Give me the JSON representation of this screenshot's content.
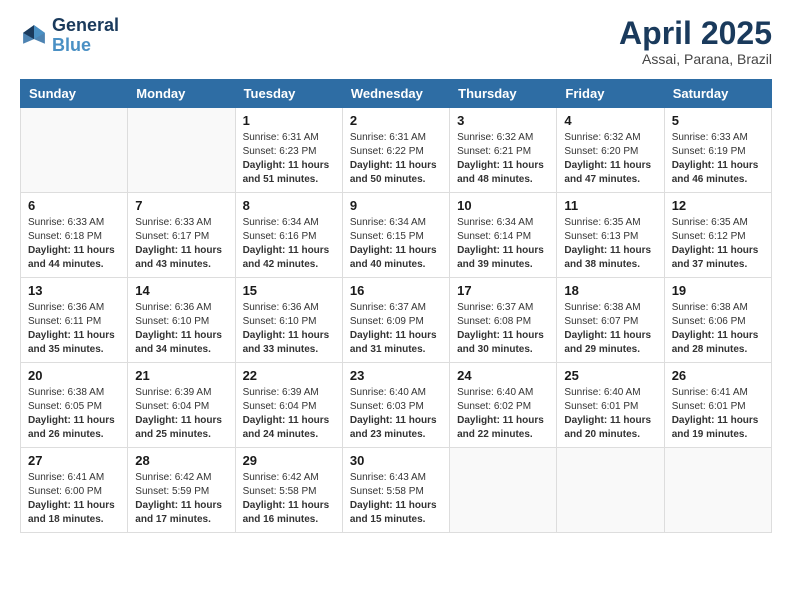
{
  "logo": {
    "line1": "General",
    "line2": "Blue"
  },
  "title": "April 2025",
  "subtitle": "Assai, Parana, Brazil",
  "days_of_week": [
    "Sunday",
    "Monday",
    "Tuesday",
    "Wednesday",
    "Thursday",
    "Friday",
    "Saturday"
  ],
  "weeks": [
    [
      {
        "day": "",
        "content": ""
      },
      {
        "day": "",
        "content": ""
      },
      {
        "day": "1",
        "content": "Sunrise: 6:31 AM\nSunset: 6:23 PM\nDaylight: 11 hours and 51 minutes."
      },
      {
        "day": "2",
        "content": "Sunrise: 6:31 AM\nSunset: 6:22 PM\nDaylight: 11 hours and 50 minutes."
      },
      {
        "day": "3",
        "content": "Sunrise: 6:32 AM\nSunset: 6:21 PM\nDaylight: 11 hours and 48 minutes."
      },
      {
        "day": "4",
        "content": "Sunrise: 6:32 AM\nSunset: 6:20 PM\nDaylight: 11 hours and 47 minutes."
      },
      {
        "day": "5",
        "content": "Sunrise: 6:33 AM\nSunset: 6:19 PM\nDaylight: 11 hours and 46 minutes."
      }
    ],
    [
      {
        "day": "6",
        "content": "Sunrise: 6:33 AM\nSunset: 6:18 PM\nDaylight: 11 hours and 44 minutes."
      },
      {
        "day": "7",
        "content": "Sunrise: 6:33 AM\nSunset: 6:17 PM\nDaylight: 11 hours and 43 minutes."
      },
      {
        "day": "8",
        "content": "Sunrise: 6:34 AM\nSunset: 6:16 PM\nDaylight: 11 hours and 42 minutes."
      },
      {
        "day": "9",
        "content": "Sunrise: 6:34 AM\nSunset: 6:15 PM\nDaylight: 11 hours and 40 minutes."
      },
      {
        "day": "10",
        "content": "Sunrise: 6:34 AM\nSunset: 6:14 PM\nDaylight: 11 hours and 39 minutes."
      },
      {
        "day": "11",
        "content": "Sunrise: 6:35 AM\nSunset: 6:13 PM\nDaylight: 11 hours and 38 minutes."
      },
      {
        "day": "12",
        "content": "Sunrise: 6:35 AM\nSunset: 6:12 PM\nDaylight: 11 hours and 37 minutes."
      }
    ],
    [
      {
        "day": "13",
        "content": "Sunrise: 6:36 AM\nSunset: 6:11 PM\nDaylight: 11 hours and 35 minutes."
      },
      {
        "day": "14",
        "content": "Sunrise: 6:36 AM\nSunset: 6:10 PM\nDaylight: 11 hours and 34 minutes."
      },
      {
        "day": "15",
        "content": "Sunrise: 6:36 AM\nSunset: 6:10 PM\nDaylight: 11 hours and 33 minutes."
      },
      {
        "day": "16",
        "content": "Sunrise: 6:37 AM\nSunset: 6:09 PM\nDaylight: 11 hours and 31 minutes."
      },
      {
        "day": "17",
        "content": "Sunrise: 6:37 AM\nSunset: 6:08 PM\nDaylight: 11 hours and 30 minutes."
      },
      {
        "day": "18",
        "content": "Sunrise: 6:38 AM\nSunset: 6:07 PM\nDaylight: 11 hours and 29 minutes."
      },
      {
        "day": "19",
        "content": "Sunrise: 6:38 AM\nSunset: 6:06 PM\nDaylight: 11 hours and 28 minutes."
      }
    ],
    [
      {
        "day": "20",
        "content": "Sunrise: 6:38 AM\nSunset: 6:05 PM\nDaylight: 11 hours and 26 minutes."
      },
      {
        "day": "21",
        "content": "Sunrise: 6:39 AM\nSunset: 6:04 PM\nDaylight: 11 hours and 25 minutes."
      },
      {
        "day": "22",
        "content": "Sunrise: 6:39 AM\nSunset: 6:04 PM\nDaylight: 11 hours and 24 minutes."
      },
      {
        "day": "23",
        "content": "Sunrise: 6:40 AM\nSunset: 6:03 PM\nDaylight: 11 hours and 23 minutes."
      },
      {
        "day": "24",
        "content": "Sunrise: 6:40 AM\nSunset: 6:02 PM\nDaylight: 11 hours and 22 minutes."
      },
      {
        "day": "25",
        "content": "Sunrise: 6:40 AM\nSunset: 6:01 PM\nDaylight: 11 hours and 20 minutes."
      },
      {
        "day": "26",
        "content": "Sunrise: 6:41 AM\nSunset: 6:01 PM\nDaylight: 11 hours and 19 minutes."
      }
    ],
    [
      {
        "day": "27",
        "content": "Sunrise: 6:41 AM\nSunset: 6:00 PM\nDaylight: 11 hours and 18 minutes."
      },
      {
        "day": "28",
        "content": "Sunrise: 6:42 AM\nSunset: 5:59 PM\nDaylight: 11 hours and 17 minutes."
      },
      {
        "day": "29",
        "content": "Sunrise: 6:42 AM\nSunset: 5:58 PM\nDaylight: 11 hours and 16 minutes."
      },
      {
        "day": "30",
        "content": "Sunrise: 6:43 AM\nSunset: 5:58 PM\nDaylight: 11 hours and 15 minutes."
      },
      {
        "day": "",
        "content": ""
      },
      {
        "day": "",
        "content": ""
      },
      {
        "day": "",
        "content": ""
      }
    ]
  ]
}
